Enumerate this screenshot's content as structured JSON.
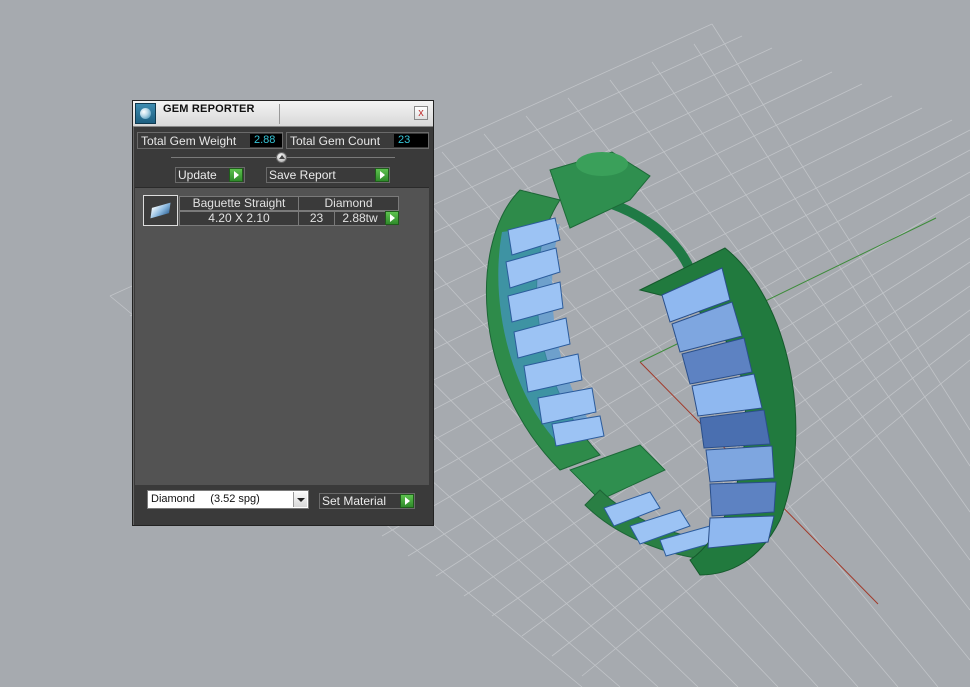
{
  "panel": {
    "title": "GEM REPORTER",
    "close_label": "x",
    "total_weight": {
      "label": "Total Gem Weight",
      "value": "2.88"
    },
    "total_count": {
      "label": "Total Gem Count",
      "value": "23"
    },
    "update_label": "Update",
    "save_report_label": "Save Report",
    "gem_row": {
      "shape": "Baguette Straight",
      "material": "Diamond",
      "size": "4.20 X 2.10",
      "count": "23",
      "weight": "2.88tw"
    },
    "material_select": {
      "value": "Diamond     (3.52 spg)"
    },
    "set_material_label": "Set Material"
  },
  "colors": {
    "viewport_bg": "#a6aaaf",
    "ring_green": "#2e8b4a",
    "gem_blue": "#8fb8f0",
    "value_cyan": "#37c6d8",
    "arrow_green": "#3fa33a"
  },
  "icons": [
    "gem-reporter-icon",
    "close-icon",
    "slider-knob",
    "play-arrow-icon",
    "dropdown-arrow-icon",
    "gem-thumbnail-icon"
  ]
}
